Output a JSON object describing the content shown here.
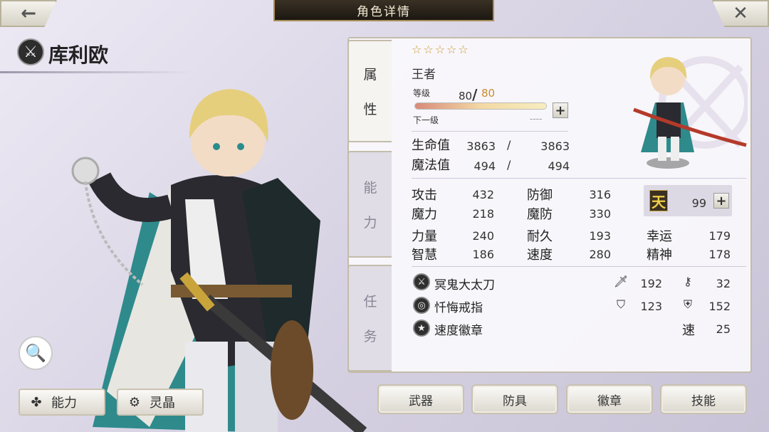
{
  "header": {
    "back_icon": "←",
    "title": "角色详情",
    "close_icon": "✕"
  },
  "character": {
    "name": "库利欧",
    "class_icon": "sword-icon"
  },
  "left_buttons": {
    "zoom_icon": "🔍",
    "ability_icon": "dots-icon",
    "ability_label": "能力",
    "crystal_icon": "crystal-icon",
    "crystal_label": "灵晶"
  },
  "tabs": [
    {
      "c1": "属",
      "c2": "性"
    },
    {
      "c1": "能",
      "c2": "力"
    },
    {
      "c1": "任",
      "c2": "务"
    }
  ],
  "attributes": {
    "stars": "☆☆☆☆☆",
    "rank": "王者",
    "level_label": "等级",
    "level_current": "80",
    "level_max": "80",
    "level_sep": "/",
    "next_label": "下一级",
    "next_value": "----",
    "exp_fraction": 1.0
  },
  "vitals": {
    "hp_label": "生命值",
    "hp": "3863",
    "hp_max": "3863",
    "mp_label": "魔法值",
    "mp": "494",
    "mp_max": "494",
    "sep": "/"
  },
  "stats": {
    "atk_label": "攻击",
    "atk": "432",
    "def_label": "防御",
    "def": "316",
    "mag_label": "魔力",
    "mag": "218",
    "mdef_label": "魔防",
    "mdef": "330",
    "str_label": "力量",
    "str": "240",
    "end_label": "耐久",
    "end": "193",
    "luck_label": "幸运",
    "luck": "179",
    "int_label": "智慧",
    "int": "186",
    "spd_label": "速度",
    "spd": "280",
    "spi_label": "精神",
    "spi": "178",
    "ten_icon": "天",
    "ten_value": "99"
  },
  "equipment": [
    {
      "name": "冥鬼大太刀",
      "icon": "sword-icon",
      "s1_icon": "blade-icon",
      "s1": "192",
      "s2_icon": "key-icon",
      "s2": "32"
    },
    {
      "name": "忏悔戒指",
      "icon": "ring-icon",
      "s1_icon": "shield-icon",
      "s1": "123",
      "s2_icon": "shield-cross-icon",
      "s2": "152"
    },
    {
      "name": "速度徽章",
      "icon": "badge-icon",
      "s2_label": "速",
      "s2": "25"
    }
  ],
  "bottom_buttons": [
    "武器",
    "防具",
    "徽章",
    "技能"
  ],
  "colors": {
    "accent_gold": "#c99a2e",
    "title_bar": "#2a2218",
    "panel_border": "#c3bcaa"
  }
}
